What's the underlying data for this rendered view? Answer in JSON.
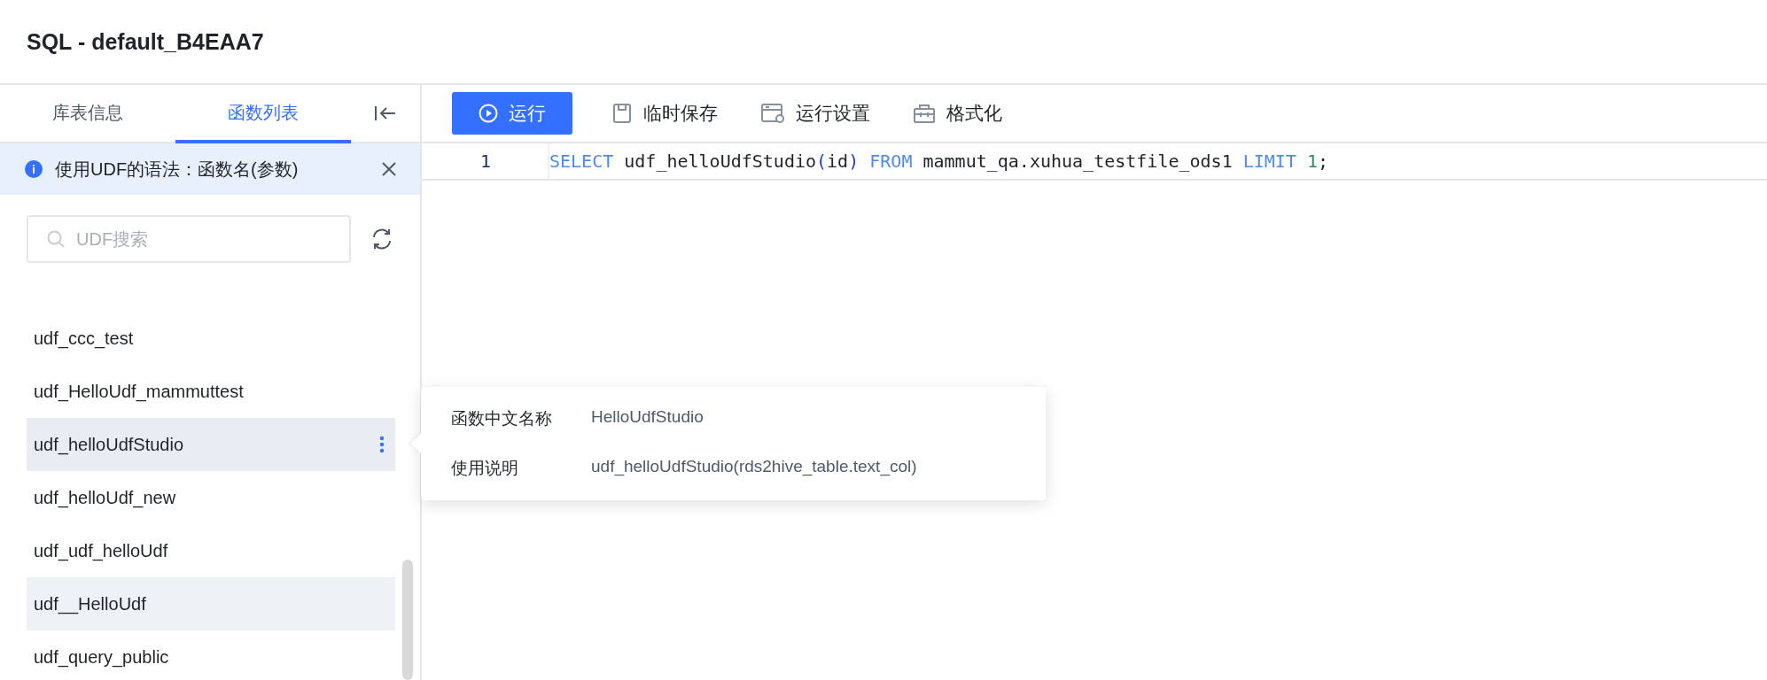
{
  "title": "SQL - default_B4EAA7",
  "sidebar": {
    "tabs": [
      {
        "label": "库表信息",
        "selected": false
      },
      {
        "label": "函数列表",
        "selected": true
      }
    ],
    "notice": {
      "text": "使用UDF的语法：函数名(参数)"
    },
    "search": {
      "placeholder": "UDF搜索"
    },
    "functions": [
      {
        "name": "udf_ccc_test",
        "hovered": false,
        "selected": false
      },
      {
        "name": "udf_HelloUdf_mammuttest",
        "hovered": false,
        "selected": false
      },
      {
        "name": "udf_helloUdfStudio",
        "hovered": true,
        "selected": true
      },
      {
        "name": "udf_helloUdf_new",
        "hovered": false,
        "selected": false
      },
      {
        "name": "udf_udf_helloUdf",
        "hovered": false,
        "selected": false
      },
      {
        "name": "udf__HelloUdf",
        "hovered": false,
        "selected": true
      },
      {
        "name": "udf_query_public",
        "hovered": false,
        "selected": false
      }
    ]
  },
  "toolbar": [
    {
      "label": "运行",
      "kind": "run"
    },
    {
      "label": "临时保存",
      "kind": "save"
    },
    {
      "label": "运行设置",
      "kind": "settings"
    },
    {
      "label": "格式化",
      "kind": "format"
    }
  ],
  "editor": {
    "lines": [
      {
        "number": "1",
        "tokens": [
          {
            "text": "SELECT",
            "kind": "keyword"
          },
          {
            "text": " udf_helloUdfStudio",
            "kind": "plain"
          },
          {
            "text": "(",
            "kind": "bracket"
          },
          {
            "text": "id",
            "kind": "plain"
          },
          {
            "text": ")",
            "kind": "bracket"
          },
          {
            "text": " FROM",
            "kind": "keyword"
          },
          {
            "text": " mammut_qa.xuhua_testfile_ods1 ",
            "kind": "plain"
          },
          {
            "text": "LIMIT",
            "kind": "keyword"
          },
          {
            "text": " 1",
            "kind": "number"
          },
          {
            "text": ";",
            "kind": "plain"
          }
        ]
      }
    ]
  },
  "popover": {
    "rows": [
      {
        "label": "函数中文名称",
        "value": "HelloUdfStudio"
      },
      {
        "label": "使用说明",
        "value": "udf_helloUdfStudio(rds2hive_table.text_col)"
      }
    ]
  }
}
